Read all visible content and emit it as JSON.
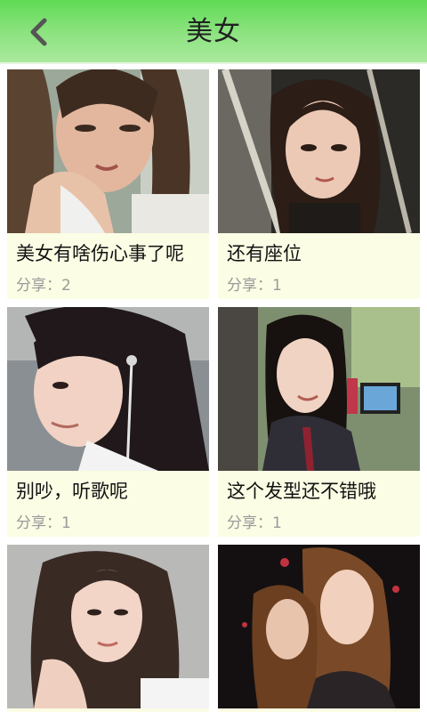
{
  "header": {
    "title": "美女",
    "back_icon": "chevron-left-icon"
  },
  "cards": [
    {
      "title": "美女有啥伤心事了呢",
      "share_label": "分享：",
      "share_count": "2"
    },
    {
      "title": "还有座位",
      "share_label": "分享：",
      "share_count": "1"
    },
    {
      "title": "别吵，听歌呢",
      "share_label": "分享：",
      "share_count": "1"
    },
    {
      "title": "这个发型还不错哦",
      "share_label": "分享：",
      "share_count": "1"
    },
    {
      "title": "",
      "share_label": "",
      "share_count": ""
    },
    {
      "title": "",
      "share_label": "",
      "share_count": ""
    }
  ],
  "colors": {
    "header_gradient_top": "#5fdb55",
    "header_gradient_bottom": "#a9ea9d",
    "card_background": "#fbfde4",
    "meta_text": "#9a9a9a"
  }
}
